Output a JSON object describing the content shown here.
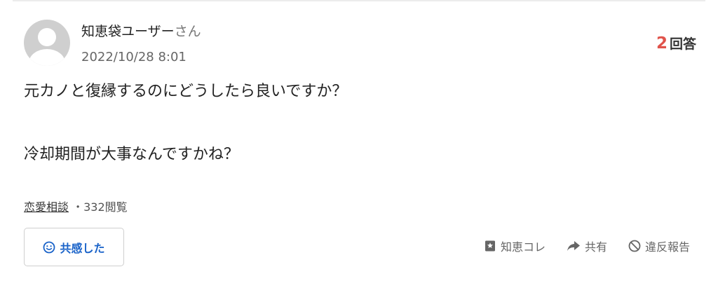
{
  "question": {
    "user_name": "知恵袋ユーザー",
    "user_suffix": "さん",
    "date": "2022/10/28 8:01",
    "answer_count": "2",
    "answer_unit": "回答",
    "body": "元カノと復縁するのにどうしたら良いですか？\n\n\n冷却期間が大事なんですかね？",
    "category": "恋愛相談",
    "separator": "・",
    "views": "332閲覧"
  },
  "actions": {
    "empathy_label": "共感した",
    "chiebukuro_label": "知恵コレ",
    "share_label": "共有",
    "report_label": "違反報告"
  },
  "colors": {
    "accent_blue": "#1a63c9",
    "answer_count_red": "#e0534b"
  },
  "icons": [
    "avatar-placeholder",
    "smile-icon",
    "bookmark-icon",
    "share-arrow-icon",
    "prohibit-icon"
  ]
}
